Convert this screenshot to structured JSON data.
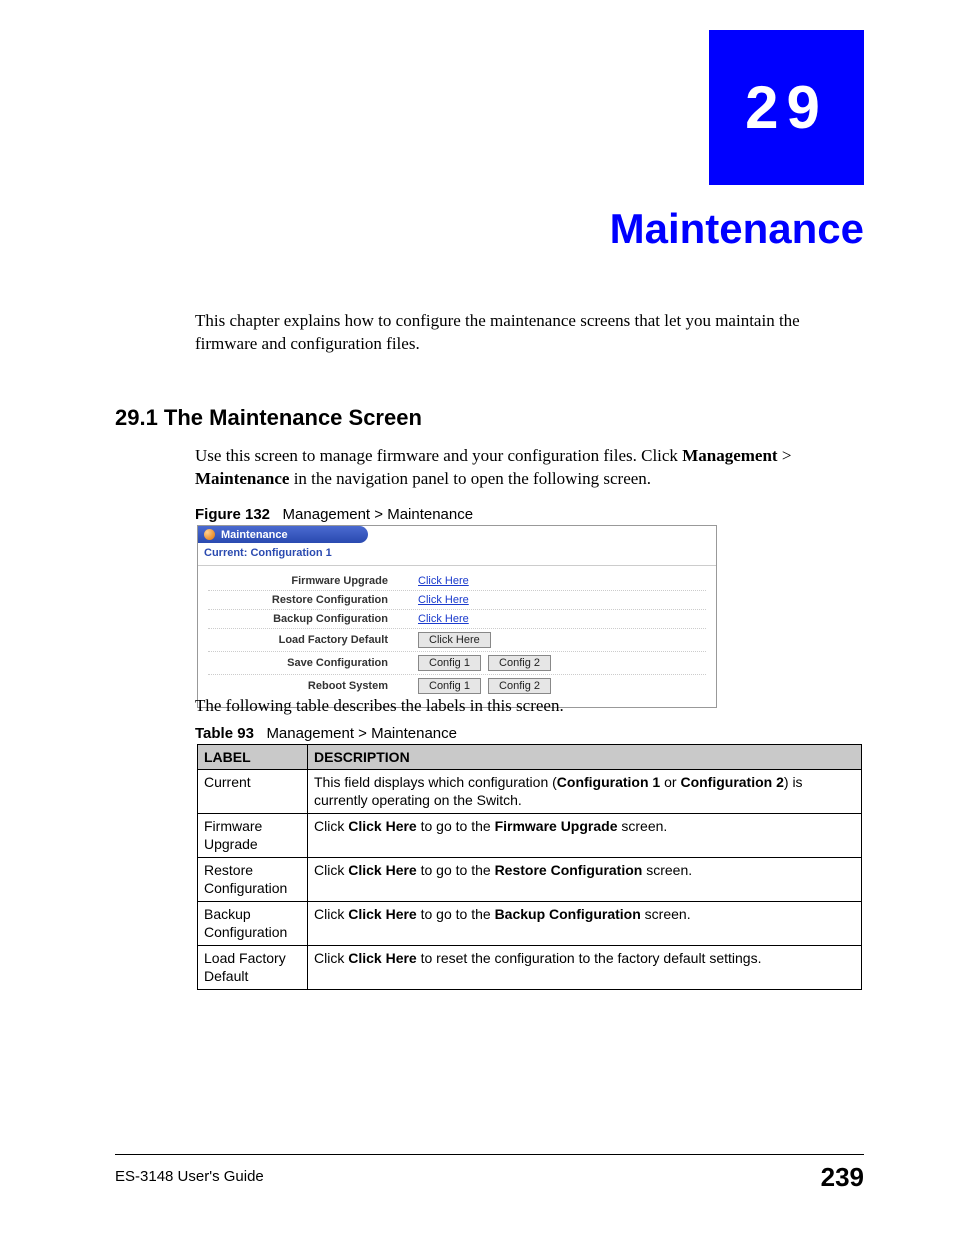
{
  "chapter": {
    "number": "29",
    "title": "Maintenance",
    "intro": "This chapter explains how to configure the maintenance screens that let you maintain the firmware and configuration files."
  },
  "section": {
    "heading": "29.1  The Maintenance Screen",
    "body_pre": "Use this screen to manage firmware and your configuration files. Click ",
    "body_b1": "Management",
    "body_mid": " > ",
    "body_b2": "Maintenance",
    "body_post": " in the navigation panel to open the following screen."
  },
  "figure": {
    "caption_label": "Figure 132",
    "caption_text": "Management > Maintenance",
    "tab": "Maintenance",
    "current": "Current: Configuration 1",
    "rows": {
      "fw_label": "Firmware Upgrade",
      "fw_link": "Click Here",
      "rc_label": "Restore Configuration",
      "rc_link": "Click Here",
      "bc_label": "Backup Configuration",
      "bc_link": "Click Here",
      "lf_label": "Load Factory Default",
      "lf_btn": "Click Here",
      "sc_label": "Save Configuration",
      "sc_btn1": "Config 1",
      "sc_btn2": "Config 2",
      "rb_label": "Reboot System",
      "rb_btn1": "Config 1",
      "rb_btn2": "Config 2"
    }
  },
  "between": "The following table describes the labels in this screen.",
  "table": {
    "caption_label": "Table 93",
    "caption_text": "Management > Maintenance",
    "head_label": "LABEL",
    "head_desc": "DESCRIPTION",
    "rows": [
      {
        "label": "Current",
        "desc_pre": "This field displays which configuration (",
        "desc_b1": "Configuration 1",
        "desc_mid": " or ",
        "desc_b2": "Configuration 2",
        "desc_post": ") is currently operating on the Switch."
      },
      {
        "label": "Firmware Upgrade",
        "desc_pre": "Click ",
        "desc_b1": "Click Here",
        "desc_mid": " to go to the ",
        "desc_b2": "Firmware Upgrade",
        "desc_post": " screen."
      },
      {
        "label": "Restore Configuration",
        "desc_pre": "Click ",
        "desc_b1": "Click Here",
        "desc_mid": " to go to the ",
        "desc_b2": "Restore Configuration",
        "desc_post": " screen."
      },
      {
        "label": "Backup Configuration",
        "desc_pre": "Click ",
        "desc_b1": "Click Here",
        "desc_mid": " to go to the ",
        "desc_b2": "Backup Configuration",
        "desc_post": " screen."
      },
      {
        "label": "Load Factory Default",
        "desc_pre": "Click ",
        "desc_b1": "Click Here",
        "desc_mid": " to reset the configuration to the factory default settings.",
        "desc_b2": "",
        "desc_post": ""
      }
    ]
  },
  "footer": {
    "guide": "ES-3148 User's Guide",
    "page": "239"
  }
}
